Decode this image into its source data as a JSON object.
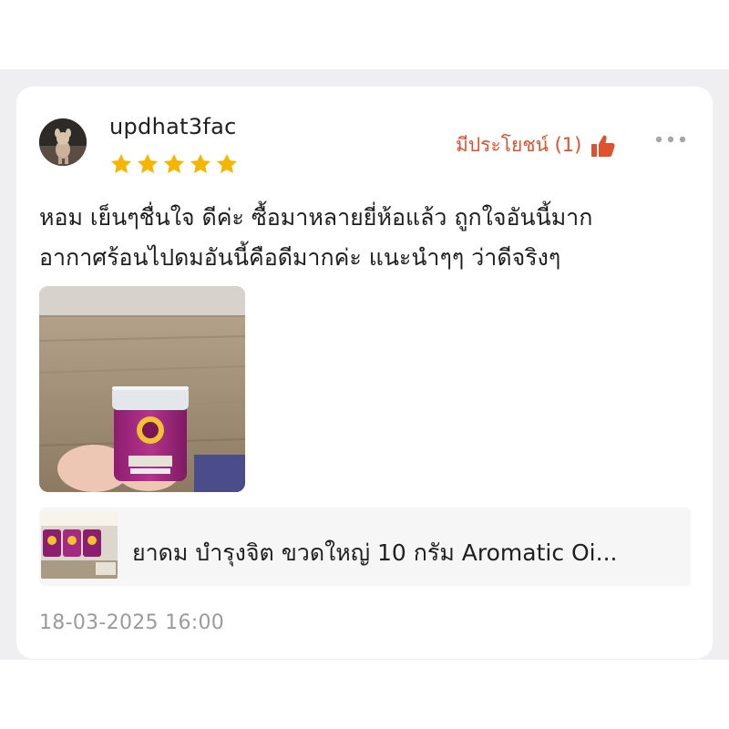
{
  "review": {
    "username": "updhat3fac",
    "rating": 5,
    "rating_max": 5,
    "helpful_label": "มีประโยชน์ (1)",
    "text_lines": [
      "หอม เย็นๆชื่นใจ ดีค่ะ ซื้อมาหลายยี่ห้อแล้ว ถูกใจอันนี้มาก",
      "อากาศร้อนไปดมอันนี้คือดีมากค่ะ แนะนำๆๆ ว่าดีจริงๆ"
    ],
    "date": "18-03-2025 16:00"
  },
  "product": {
    "title": "ยาดม บำรุงจิต ขวดใหญ่ 10 กรัม Aromatic Oi..."
  },
  "colors": {
    "accent": "#e0522d",
    "star": "#f7b500",
    "background_band": "#efeff1",
    "muted_text": "#9b9b9f"
  },
  "icons": {
    "helpful": "thumbs-up-icon",
    "more": "more-dots-icon",
    "rating": "star-icon"
  }
}
